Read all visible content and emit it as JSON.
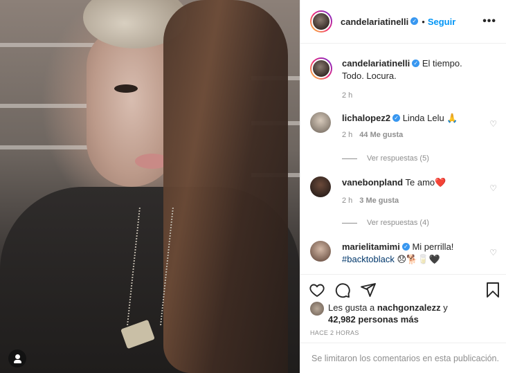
{
  "post": {
    "author": "candelariatinelli",
    "follow_label": "Seguir",
    "more_icon": "more-horizontal-icon",
    "caption": "El tiempo. Todo. Locura.",
    "caption_time": "2 h"
  },
  "comments": [
    {
      "user": "lichalopez2",
      "verified": true,
      "text": "Linda Lelu 🙏",
      "time": "2 h",
      "likes": "44 Me gusta",
      "replies": "Ver respuestas (5)"
    },
    {
      "user": "vanebonpland",
      "verified": false,
      "text": "Te amo❤️",
      "time": "2 h",
      "likes": "3 Me gusta",
      "replies": "Ver respuestas (4)"
    },
    {
      "user": "marielitamimi",
      "verified": true,
      "text": "Mi perrilla!",
      "hashtag": "#backtoblack",
      "emojis": "😞🐕🥛🖤"
    }
  ],
  "likes": {
    "prefix": "Les gusta a",
    "user": "nachgonzalezz",
    "connector": "y",
    "others": "42,982 personas más"
  },
  "time_ago": "HACE 2 HORAS",
  "comments_limited": "Se limitaron los comentarios en esta publicación.",
  "colors": {
    "accent": "#0095f6",
    "verified": "#3897f0",
    "muted": "#8e8e8e",
    "text": "#262626",
    "border": "#efefef"
  }
}
